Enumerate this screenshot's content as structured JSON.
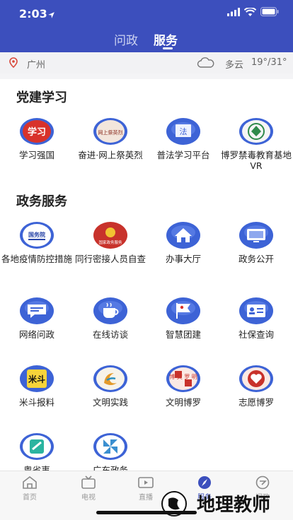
{
  "status": {
    "time": "2:03"
  },
  "tabs": [
    {
      "label": "问政",
      "active": false
    },
    {
      "label": "服务",
      "active": true
    }
  ],
  "location": {
    "city": "广州",
    "condition": "多云",
    "temperature": "19°/31°"
  },
  "sections": [
    {
      "title": "党建学习",
      "items": [
        {
          "label": "学习强国",
          "icon": "xuexi-qiangguo-icon",
          "logo_text": "学习"
        },
        {
          "label": "奋进·网上祭英烈",
          "icon": "memorial-icon",
          "logo_text": "网上祭英烈"
        },
        {
          "label": "普法学习平台",
          "icon": "law-book-icon",
          "logo_text": "法"
        },
        {
          "label": "博罗禁毒教育基地VR",
          "icon": "anti-drug-emblem-icon"
        }
      ]
    },
    {
      "title": "政务服务",
      "items": [
        {
          "label": "各地疫情防控措施",
          "icon": "state-council-icon",
          "logo_text": "国务院"
        },
        {
          "label": "同行密接人员自查",
          "icon": "national-emblem-icon",
          "logo_text": "国家政务服务"
        },
        {
          "label": "办事大厅",
          "icon": "house-icon"
        },
        {
          "label": "政务公开",
          "icon": "monitor-icon"
        },
        {
          "label": "网络问政",
          "icon": "chat-bubble-icon"
        },
        {
          "label": "在线访谈",
          "icon": "coffee-cup-icon"
        },
        {
          "label": "智慧团建",
          "icon": "flag-icon"
        },
        {
          "label": "社保查询",
          "icon": "id-card-icon"
        },
        {
          "label": "米斗报料",
          "icon": "midou-icon",
          "logo_text": "米斗"
        },
        {
          "label": "文明实践",
          "icon": "civilization-swirl-icon"
        },
        {
          "label": "文明博罗",
          "icon": "civilization-boluo-icon",
          "logo_text": "博 文 罗 明"
        },
        {
          "label": "志愿博罗",
          "icon": "volunteer-heart-icon"
        },
        {
          "label": "粤省事",
          "icon": "yueshengshi-icon"
        },
        {
          "label": "广东政务",
          "icon": "pinwheel-icon"
        }
      ]
    }
  ],
  "bottom_nav": [
    {
      "label": "首页",
      "icon": "home-icon",
      "active": false
    },
    {
      "label": "电视",
      "icon": "tv-icon",
      "active": false
    },
    {
      "label": "直播",
      "icon": "live-video-icon",
      "active": false
    },
    {
      "label": "服务",
      "icon": "compass-icon",
      "active": true
    },
    {
      "label": "问政",
      "icon": "message-icon",
      "active": false
    }
  ],
  "watermark": {
    "text": "地理教师"
  },
  "colors": {
    "brand": "#3c4fbd",
    "icon_blue": "#3d63d6",
    "red": "#c8322b"
  }
}
